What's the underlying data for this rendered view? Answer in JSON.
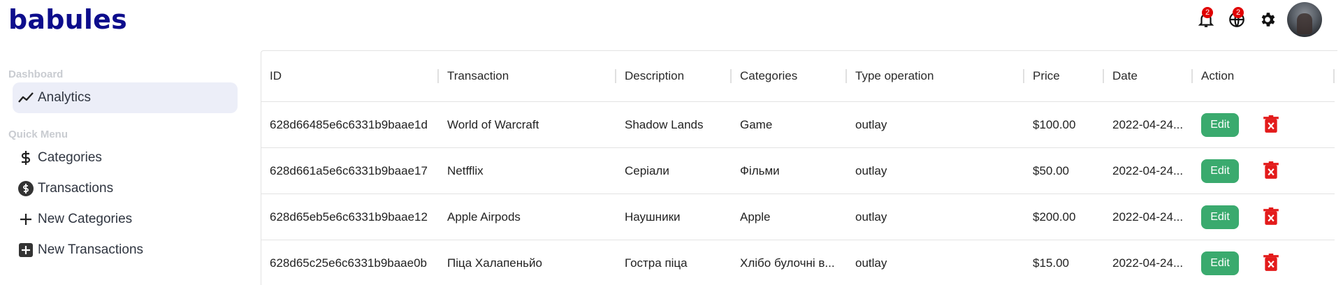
{
  "app": {
    "logo": "babules"
  },
  "header": {
    "notifications_count": "2",
    "language_count": "2",
    "icons": [
      "bell-icon",
      "globe-icon",
      "gear-icon",
      "avatar"
    ]
  },
  "sidebar": {
    "dashboard_title": "Dashboard",
    "analytics_label": "Analytics",
    "quick_menu_title": "Quick Menu",
    "items": [
      {
        "label": "Categories",
        "icon": "dollar-icon"
      },
      {
        "label": "Transactions",
        "icon": "dollar-circle-icon"
      },
      {
        "label": "New Categories",
        "icon": "plus-icon"
      },
      {
        "label": "New Transactions",
        "icon": "plus-square-icon"
      }
    ]
  },
  "table": {
    "columns": [
      "ID",
      "Transaction",
      "Description",
      "Categories",
      "Type operation",
      "Price",
      "Date",
      "Action"
    ],
    "edit_label": "Edit",
    "rows": [
      {
        "id": "628d66485e6c6331b9baae1d",
        "transaction": "World of Warcraft",
        "description": "Shadow Lands",
        "category": "Game",
        "type": "outlay",
        "price": "$100.00",
        "date": "2022-04-24..."
      },
      {
        "id": "628d661a5e6c6331b9baae17",
        "transaction": "Netfflix",
        "description": "Серіали",
        "category": "Фільми",
        "type": "outlay",
        "price": "$50.00",
        "date": "2022-04-24..."
      },
      {
        "id": "628d65eb5e6c6331b9baae12",
        "transaction": "Apple Airpods",
        "description": "Наушники",
        "category": "Apple",
        "type": "outlay",
        "price": "$200.00",
        "date": "2022-04-24..."
      },
      {
        "id": "628d65c25e6c6331b9baae0b",
        "transaction": "Піца Халапеньйо",
        "description": "Гостра піца",
        "category": "Хлібо булочні в...",
        "type": "outlay",
        "price": "$15.00",
        "date": "2022-04-24..."
      }
    ]
  },
  "colors": {
    "logo": "#0d0d8c",
    "badge": "#e00000",
    "edit_button": "#3aaa6e",
    "delete_icon": "#e31b1b",
    "active_nav": "#eceef8"
  }
}
